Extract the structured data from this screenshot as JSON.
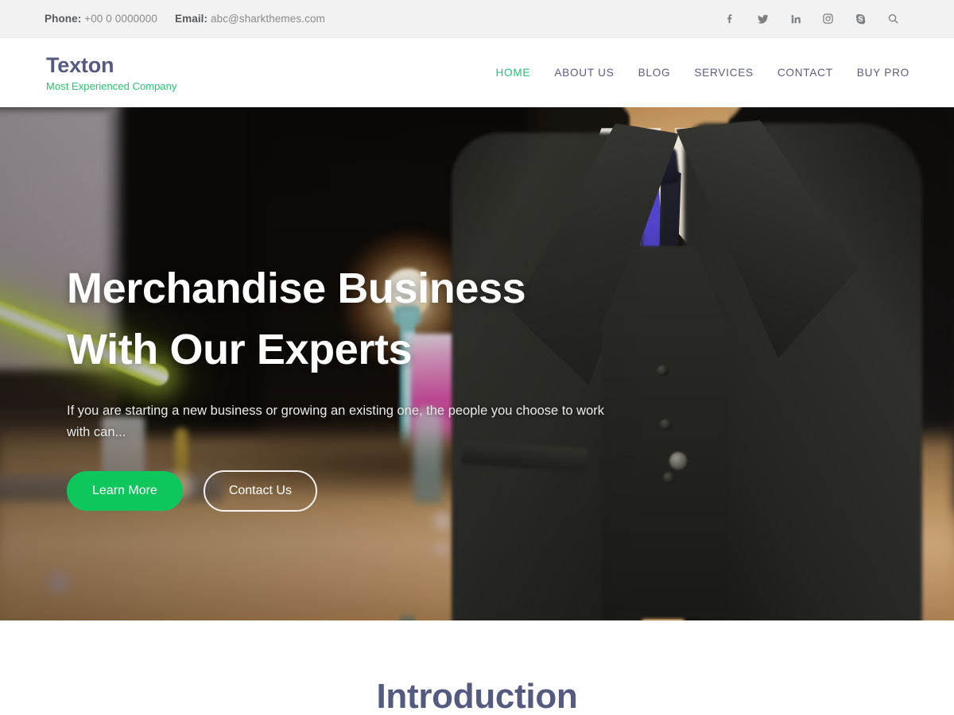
{
  "topbar": {
    "phone_label": "Phone:",
    "phone_value": "+00 0 0000000",
    "email_label": "Email:",
    "email_value": "abc@sharkthemes.com",
    "social": [
      {
        "name": "facebook-icon",
        "title": "Facebook"
      },
      {
        "name": "twitter-icon",
        "title": "Twitter"
      },
      {
        "name": "linkedin-icon",
        "title": "LinkedIn"
      },
      {
        "name": "instagram-icon",
        "title": "Instagram"
      },
      {
        "name": "skype-icon",
        "title": "Skype"
      },
      {
        "name": "search-icon",
        "title": "Search"
      }
    ]
  },
  "header": {
    "brand_name": "Texton",
    "brand_tagline": "Most Experienced Company",
    "nav": [
      {
        "label": "HOME",
        "active": true
      },
      {
        "label": "ABOUT US",
        "active": false
      },
      {
        "label": "BLOG",
        "active": false
      },
      {
        "label": "SERVICES",
        "active": false
      },
      {
        "label": "CONTACT",
        "active": false
      },
      {
        "label": "BUY PRO",
        "active": false
      }
    ]
  },
  "hero": {
    "title_line1": "Merchandise Business",
    "title_line2": "With Our Experts",
    "description": "If you are starting a new business or growing an existing one, the people you choose to work with can...",
    "primary_button": "Learn More",
    "secondary_button": "Contact Us"
  },
  "intro": {
    "title": "Introduction"
  },
  "colors": {
    "accent_green": "#0ec75c",
    "nav_active_green": "#1ec47a",
    "brand_slate": "#555a80",
    "topbar_bg": "#f2f2f2",
    "nav_text": "#5a5f80"
  }
}
